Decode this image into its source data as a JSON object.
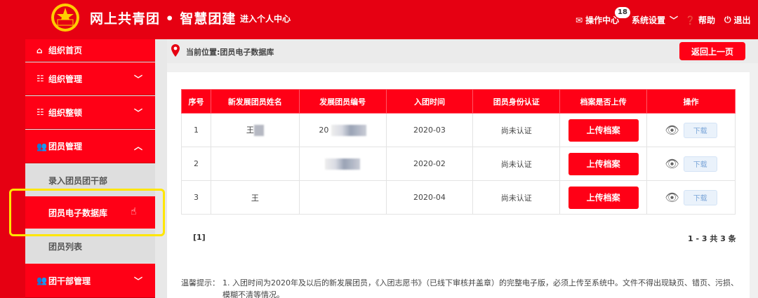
{
  "header": {
    "title": "网上共青团 • 智慧团建",
    "personal_center": "进入个人中心",
    "ops_center": "操作中心",
    "badge_count": "18",
    "settings": "系统设置",
    "help": "帮助",
    "logout": "退出"
  },
  "sidebar": {
    "org_home": "组织首页",
    "org_manage": "组织管理",
    "org_rectify": "组织整顿",
    "member_manage": "团员管理",
    "sub_enter": "录入团员团干部",
    "sub_database": "团员电子数据库",
    "sub_list": "团员列表",
    "cadre_manage": "团干部管理"
  },
  "breadcrumb": {
    "text": "当前位置:团员电子数据库",
    "back": "返回上一页"
  },
  "table": {
    "headers": [
      "序号",
      "新发展团员姓名",
      "发展团员编号",
      "入团时间",
      "团员身份认证",
      "档案是否上传",
      "操作"
    ],
    "rows": [
      {
        "no": "1",
        "name": "王",
        "code": "20",
        "date": "2020-03",
        "auth": "尚未认证"
      },
      {
        "no": "2",
        "name": "",
        "code": "",
        "date": "2020-02",
        "auth": "尚未认证"
      },
      {
        "no": "3",
        "name": "王",
        "code": "",
        "date": "2020-04",
        "auth": "尚未认证"
      }
    ],
    "upload_label": "上传档案",
    "download_label": "下载"
  },
  "pager": {
    "page": "[1]",
    "count": "1 - 3   共 3 条"
  },
  "tip": {
    "label": "温馨提示：",
    "body": "1. 入团时间为2020年及以后的新发展团员，《入团志愿书》（已线下审核并盖章）的完整电子版，必须上传至系统中。文件不得出现缺页、错页、污损、模糊不清等情况。"
  },
  "colors": {
    "brand_red": "#e60012",
    "highlight_yellow": "#ffe600"
  }
}
